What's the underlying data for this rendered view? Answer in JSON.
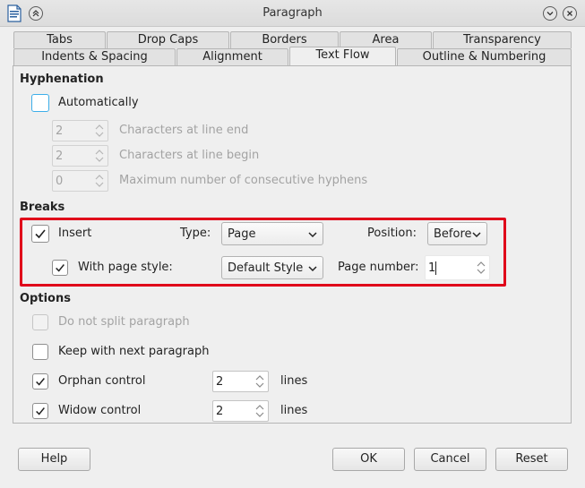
{
  "window": {
    "title": "Paragraph"
  },
  "tabs_row1": [
    {
      "label": "Tabs"
    },
    {
      "label": "Drop Caps"
    },
    {
      "label": "Borders"
    },
    {
      "label": "Area"
    },
    {
      "label": "Transparency"
    }
  ],
  "tabs_row2": [
    {
      "label": "Indents & Spacing"
    },
    {
      "label": "Alignment"
    },
    {
      "label": "Text Flow",
      "active": true
    },
    {
      "label": "Outline & Numbering"
    }
  ],
  "hyphenation": {
    "title": "Hyphenation",
    "automatically": {
      "label": "Automatically",
      "checked": false
    },
    "chars_line_end": {
      "value": "2",
      "label": "Characters at line end"
    },
    "chars_line_begin": {
      "value": "2",
      "label": "Characters at line begin"
    },
    "max_hyphens": {
      "value": "0",
      "label": "Maximum number of consecutive hyphens"
    }
  },
  "breaks": {
    "title": "Breaks",
    "insert": {
      "label": "Insert",
      "checked": true
    },
    "type_label": "Type:",
    "type_value": "Page",
    "position_label": "Position:",
    "position_value": "Before",
    "with_page_style": {
      "label": "With page style:",
      "checked": true
    },
    "page_style_value": "Default Style",
    "page_number_label": "Page number:",
    "page_number_value": "1"
  },
  "options": {
    "title": "Options",
    "do_not_split": {
      "label": "Do not split paragraph",
      "checked": false
    },
    "keep_with_next": {
      "label": "Keep with next paragraph",
      "checked": false
    },
    "orphan": {
      "label": "Orphan control",
      "checked": true,
      "value": "2",
      "unit": "lines"
    },
    "widow": {
      "label": "Widow control",
      "checked": true,
      "value": "2",
      "unit": "lines"
    }
  },
  "buttons": {
    "help": "Help",
    "ok": "OK",
    "cancel": "Cancel",
    "reset": "Reset"
  },
  "colors": {
    "highlight": "#e0001a",
    "focus": "#3daee9"
  }
}
